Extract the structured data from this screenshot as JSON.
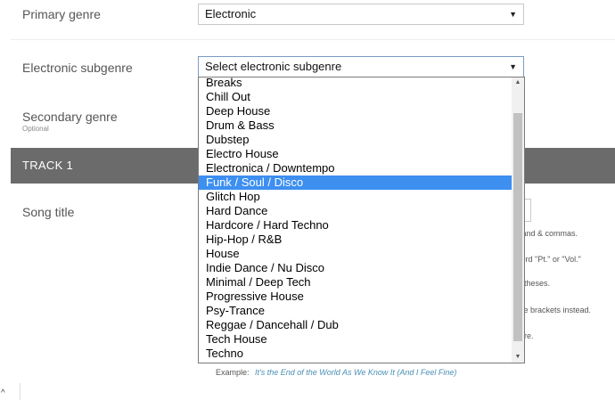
{
  "primary_genre": {
    "label": "Primary genre",
    "value": "Electronic"
  },
  "electronic_subgenre": {
    "label": "Electronic subgenre",
    "value": "Select electronic subgenre"
  },
  "secondary_genre": {
    "label": "Secondary genre",
    "sublabel": "Optional"
  },
  "track": {
    "title": "TRACK 1"
  },
  "song_title": {
    "label": "Song title",
    "hints": [
      "rsand & commas.",
      "word \"Pt.\" or \"Vol.\"",
      "entheses.",
      "use brackets instead.",
      "here."
    ],
    "example_label": "Example:",
    "example_value": "It's the End of the World As We Know It (And I Feel Fine)"
  },
  "dropdown": {
    "options": [
      "Breaks",
      "Chill Out",
      "Deep House",
      "Drum & Bass",
      "Dubstep",
      "Electro House",
      "Electronica / Downtempo",
      "Funk / Soul / Disco",
      "Glitch Hop",
      "Hard Dance",
      "Hardcore / Hard Techno",
      "Hip-Hop / R&B",
      "House",
      "Indie Dance / Nu Disco",
      "Minimal / Deep Tech",
      "Progressive House",
      "Psy-Trance",
      "Reggae / Dancehall / Dub",
      "Tech House",
      "Techno"
    ],
    "highlighted": "Funk / Soul / Disco"
  },
  "icons": {
    "select_arrow": "dropdown-arrow-icon",
    "scroll_up": "scroll-up-icon",
    "scroll_down": "scroll-down-icon",
    "caret": "caret-up-icon"
  },
  "colors": {
    "track_bar": "#6b6b6b",
    "highlight": "#3d8ff0",
    "example_link": "#4a8fb5"
  }
}
